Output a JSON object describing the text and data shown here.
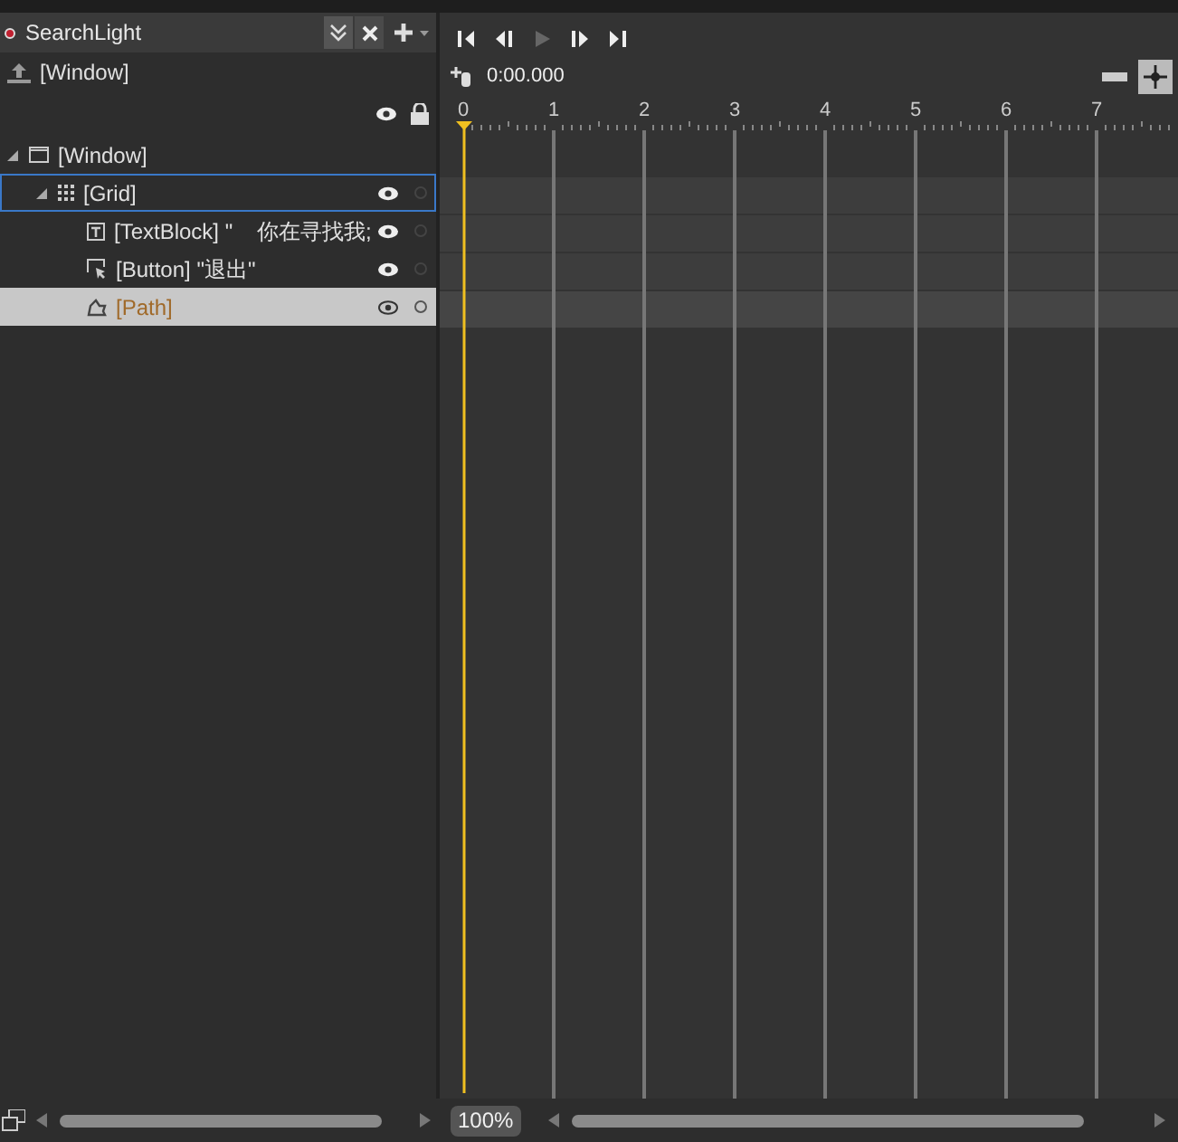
{
  "panel": {
    "title": "SearchLight",
    "scope": "[Window]"
  },
  "tree": [
    {
      "label": "[Window]",
      "kind": "window",
      "expanded": true,
      "selected": false,
      "focused": false,
      "children": [
        {
          "label": "[Grid]",
          "kind": "grid",
          "expanded": true,
          "selected": false,
          "focused": true,
          "children": [
            {
              "label": "[TextBlock] \"    你在寻找我;",
              "kind": "textblock",
              "selected": false,
              "focused": false
            },
            {
              "label": "[Button] \"退出\"",
              "kind": "button",
              "selected": false,
              "focused": false
            },
            {
              "label": "[Path]",
              "kind": "path",
              "selected": true,
              "focused": false
            }
          ]
        }
      ]
    }
  ],
  "timeline": {
    "time": "0:00.000",
    "ruler": [
      "0",
      "1",
      "2",
      "3",
      "4",
      "5",
      "6",
      "7"
    ]
  },
  "zoom": "100%"
}
